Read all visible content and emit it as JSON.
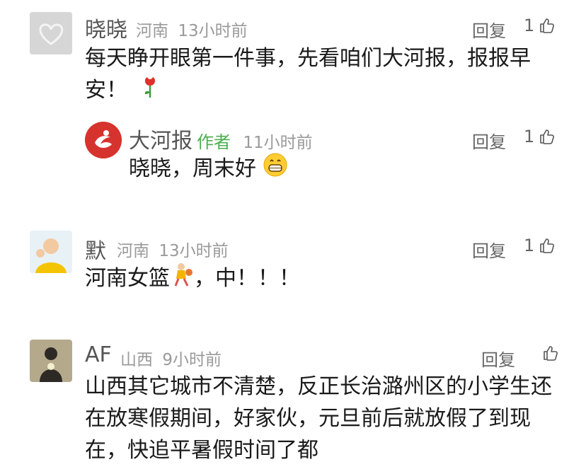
{
  "comments": [
    {
      "name": "晓晓",
      "location": "河南",
      "time": "13小时前",
      "reply_label": "回复",
      "likes": "1",
      "text_lines": [
        "每天睁开眼第一件事，先看咱们大河报，报报早",
        "安！"
      ],
      "emoji": "rose-icon",
      "reply": {
        "name": "大河报",
        "author_tag": "作者",
        "time": "11小时前",
        "reply_label": "回复",
        "likes": "1",
        "text": "晓晓，周末好",
        "emoji": "grin-face-icon"
      }
    },
    {
      "name": "默",
      "location": "河南",
      "time": "13小时前",
      "reply_label": "回复",
      "likes": "1",
      "text_lines": [
        "河南女篮",
        "，中！！！"
      ],
      "emoji": "basketball-player-icon"
    },
    {
      "name": "AF",
      "location": "山西",
      "time": "9小时前",
      "reply_label": "回复",
      "likes": "",
      "text_lines": [
        "山西其它城市不清楚，反正长治潞州区的小学生还",
        "在放寒假期间，好家伙，元旦前后就放假了到现",
        "在，快追平暑假时间了都"
      ]
    }
  ],
  "colors": {
    "author_tag": "#4caf50",
    "brand_red": "#d7332e",
    "meta_gray": "#9a9a9a"
  }
}
